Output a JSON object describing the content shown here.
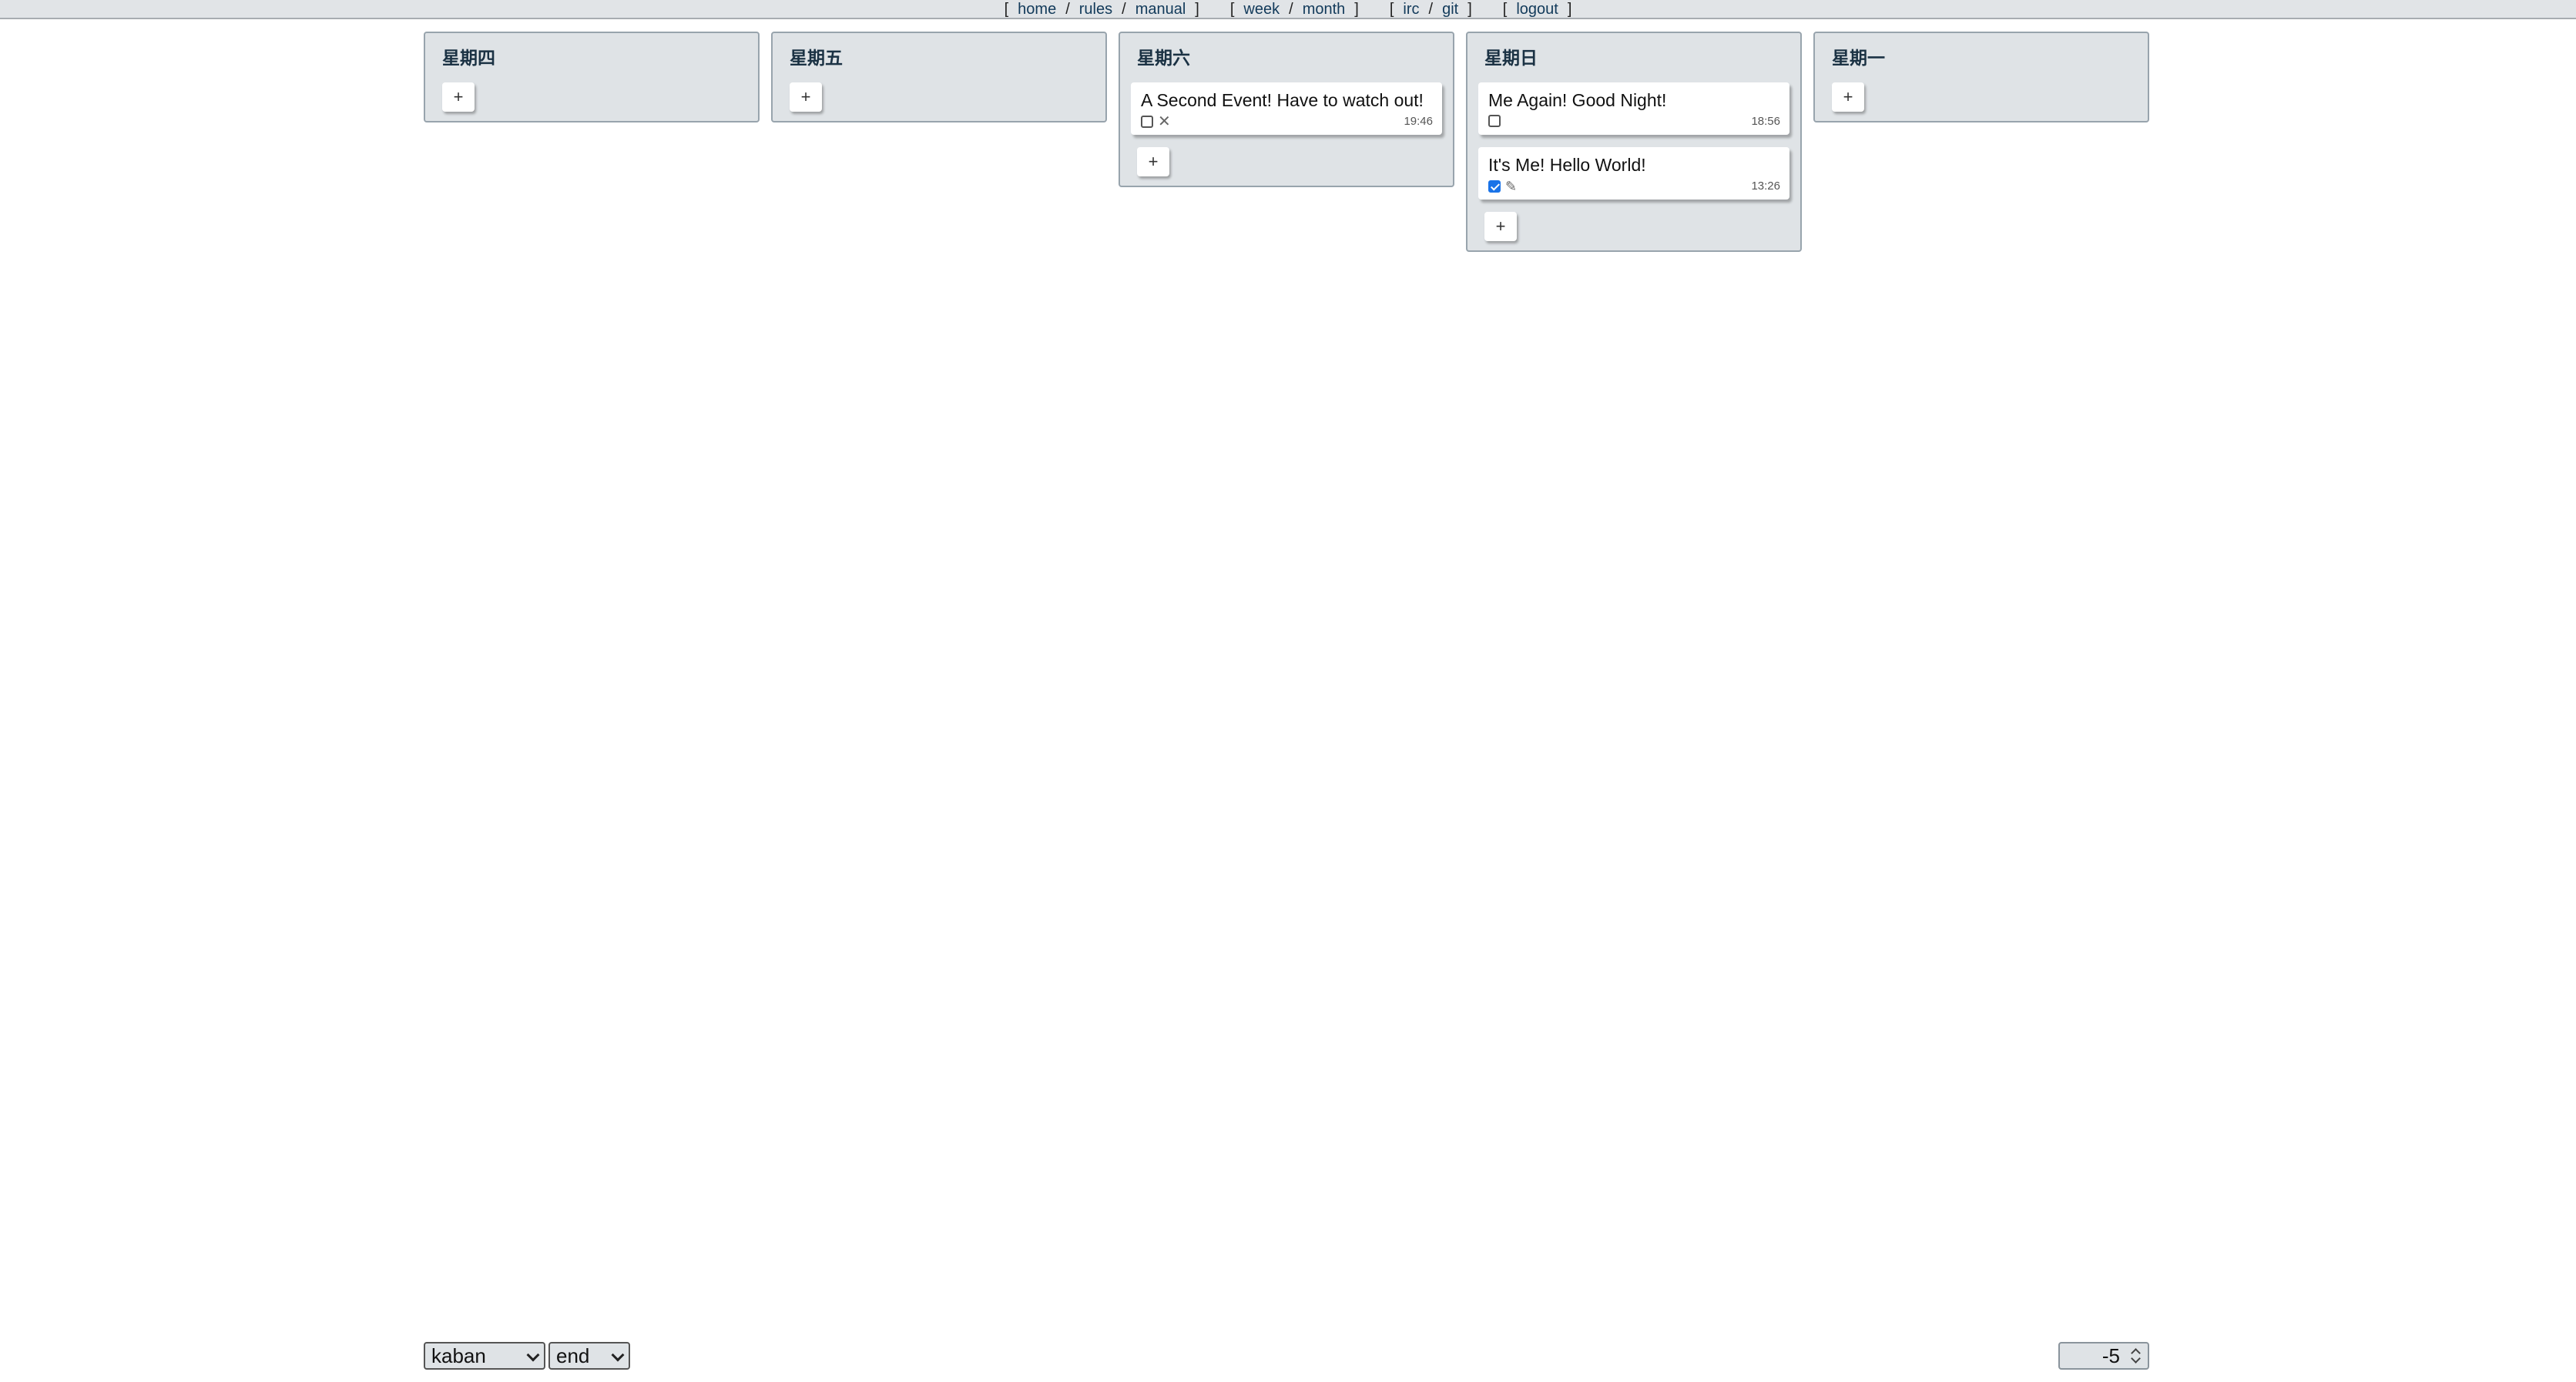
{
  "nav": {
    "groups": [
      [
        "home",
        "rules",
        "manual"
      ],
      [
        "week",
        "month"
      ],
      [
        "irc",
        "git"
      ],
      [
        "logout"
      ]
    ]
  },
  "columns": [
    {
      "title": "星期四",
      "cards": []
    },
    {
      "title": "星期五",
      "cards": []
    },
    {
      "title": "星期六",
      "cards": [
        {
          "title": "A Second Event! Have to watch out!",
          "checked": false,
          "icon": "close-icon",
          "time": "19:46"
        }
      ]
    },
    {
      "title": "星期日",
      "cards": [
        {
          "title": "Me Again! Good Night!",
          "checked": false,
          "icon": null,
          "time": "18:56"
        },
        {
          "title": "It's Me! Hello World!",
          "checked": true,
          "icon": "pencil-icon",
          "time": "13:26"
        }
      ]
    },
    {
      "title": "星期一",
      "cards": []
    }
  ],
  "add_label": "+",
  "footer": {
    "view_select": "kaban",
    "align_select": "end",
    "offset_value": "-5"
  }
}
